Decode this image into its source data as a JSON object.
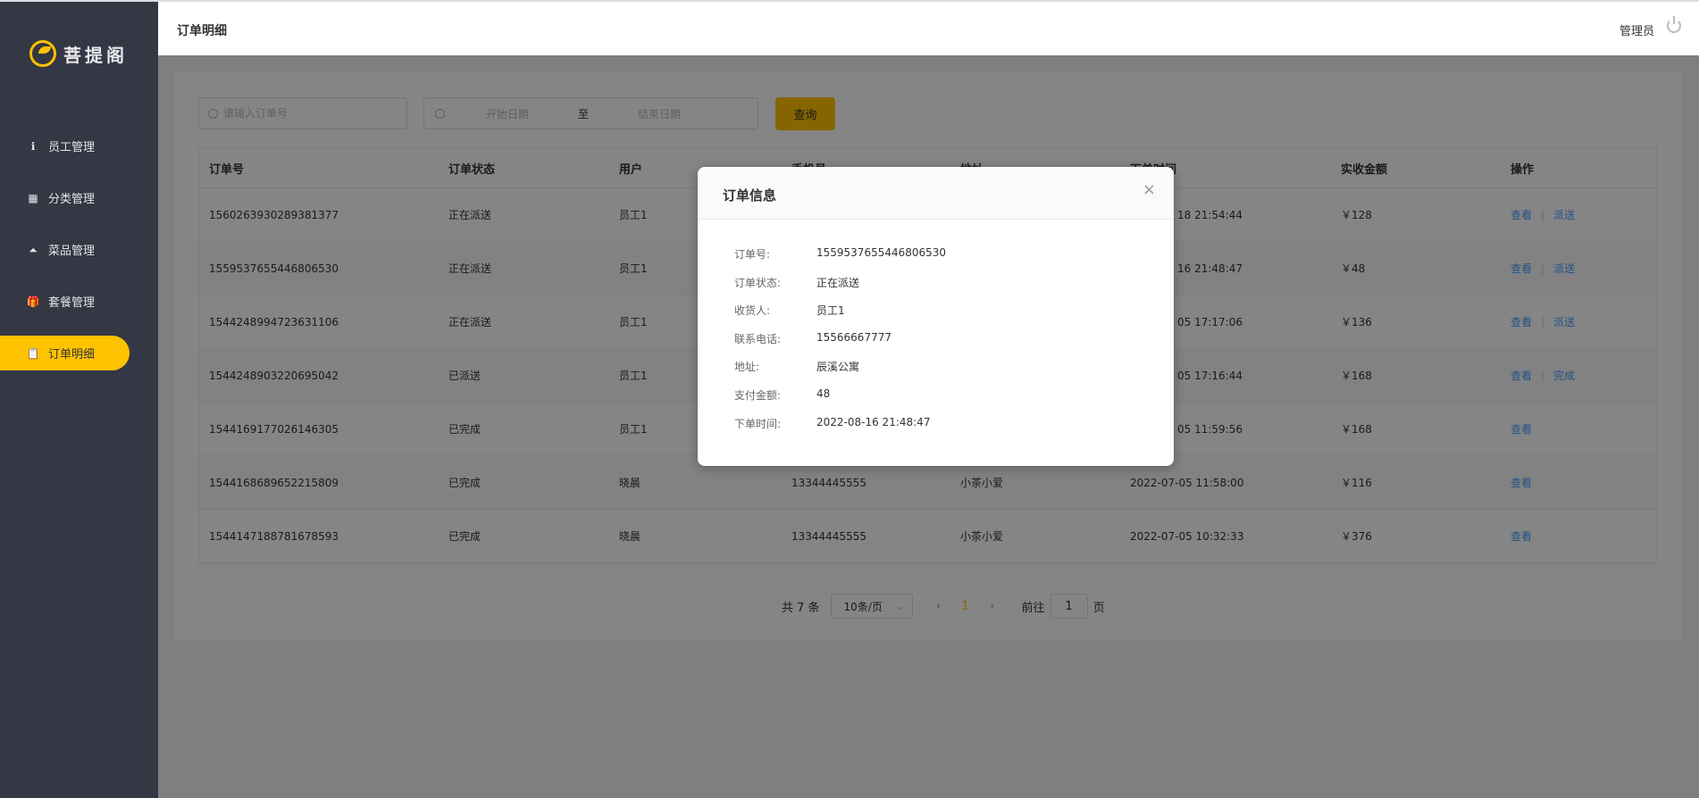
{
  "brand": {
    "name": "菩提阁"
  },
  "sidebar": {
    "items": [
      {
        "label": "员工管理",
        "icon": "info-icon",
        "active": false
      },
      {
        "label": "分类管理",
        "icon": "grid-icon",
        "active": false
      },
      {
        "label": "菜品管理",
        "icon": "cloche-icon",
        "active": false
      },
      {
        "label": "套餐管理",
        "icon": "gift-icon",
        "active": false
      },
      {
        "label": "订单明细",
        "icon": "clipboard-icon",
        "active": true
      }
    ]
  },
  "header": {
    "title": "订单明细",
    "user": "管理员"
  },
  "filters": {
    "search_placeholder": "请输入订单号",
    "start_placeholder": "开始日期",
    "separator": "至",
    "end_placeholder": "结束日期",
    "query_label": "查询"
  },
  "table": {
    "columns": [
      "订单号",
      "订单状态",
      "用户",
      "手机号",
      "地址",
      "下单时间",
      "实收金额",
      "操作"
    ],
    "rows": [
      {
        "id": "1560263930289381377",
        "status": "正在派送",
        "user": "员工1",
        "phone": "",
        "address": "",
        "time": "18 21:54:44",
        "amount": "￥128",
        "actions": [
          "查看",
          "派送"
        ]
      },
      {
        "id": "1559537655446806530",
        "status": "正在派送",
        "user": "员工1",
        "phone": "",
        "address": "",
        "time": "16 21:48:47",
        "amount": "￥48",
        "actions": [
          "查看",
          "派送"
        ]
      },
      {
        "id": "1544248994723631106",
        "status": "正在派送",
        "user": "员工1",
        "phone": "",
        "address": "",
        "time": "05 17:17:06",
        "amount": "￥136",
        "actions": [
          "查看",
          "派送"
        ]
      },
      {
        "id": "1544248903220695042",
        "status": "已派送",
        "user": "员工1",
        "phone": "",
        "address": "",
        "time": "05 17:16:44",
        "amount": "￥168",
        "actions": [
          "查看",
          "完成"
        ]
      },
      {
        "id": "1544169177026146305",
        "status": "已完成",
        "user": "员工1",
        "phone": "",
        "address": "",
        "time": "05 11:59:56",
        "amount": "￥168",
        "actions": [
          "查看"
        ]
      },
      {
        "id": "1544168689652215809",
        "status": "已完成",
        "user": "晓晨",
        "phone": "13344445555",
        "address": "小茶小爱",
        "time": "2022-07-05 11:58:00",
        "amount": "￥116",
        "actions": [
          "查看"
        ]
      },
      {
        "id": "1544147188781678593",
        "status": "已完成",
        "user": "晓晨",
        "phone": "13344445555",
        "address": "小茶小爱",
        "time": "2022-07-05 10:32:33",
        "amount": "￥376",
        "actions": [
          "查看"
        ]
      }
    ]
  },
  "pagination": {
    "total": "共 7 条",
    "page_size": "10条/页",
    "current": "1",
    "goto_label": "前往",
    "goto_value": "1",
    "page_suffix": "页",
    "prev": "‹",
    "next": "›"
  },
  "modal": {
    "title": "订单信息",
    "close": "×",
    "fields": [
      {
        "label": "订单号:",
        "value": "1559537655446806530"
      },
      {
        "label": "订单状态:",
        "value": "正在派送"
      },
      {
        "label": "收货人:",
        "value": "员工1"
      },
      {
        "label": "联系电话:",
        "value": "15566667777"
      },
      {
        "label": "地址:",
        "value": "辰溪公寓"
      },
      {
        "label": "支付金额:",
        "value": "48"
      },
      {
        "label": "下单时间:",
        "value": "2022-08-16 21:48:47"
      }
    ]
  },
  "colors": {
    "accent": "#ffc200",
    "sidebar": "#343744",
    "link": "#419eff"
  }
}
